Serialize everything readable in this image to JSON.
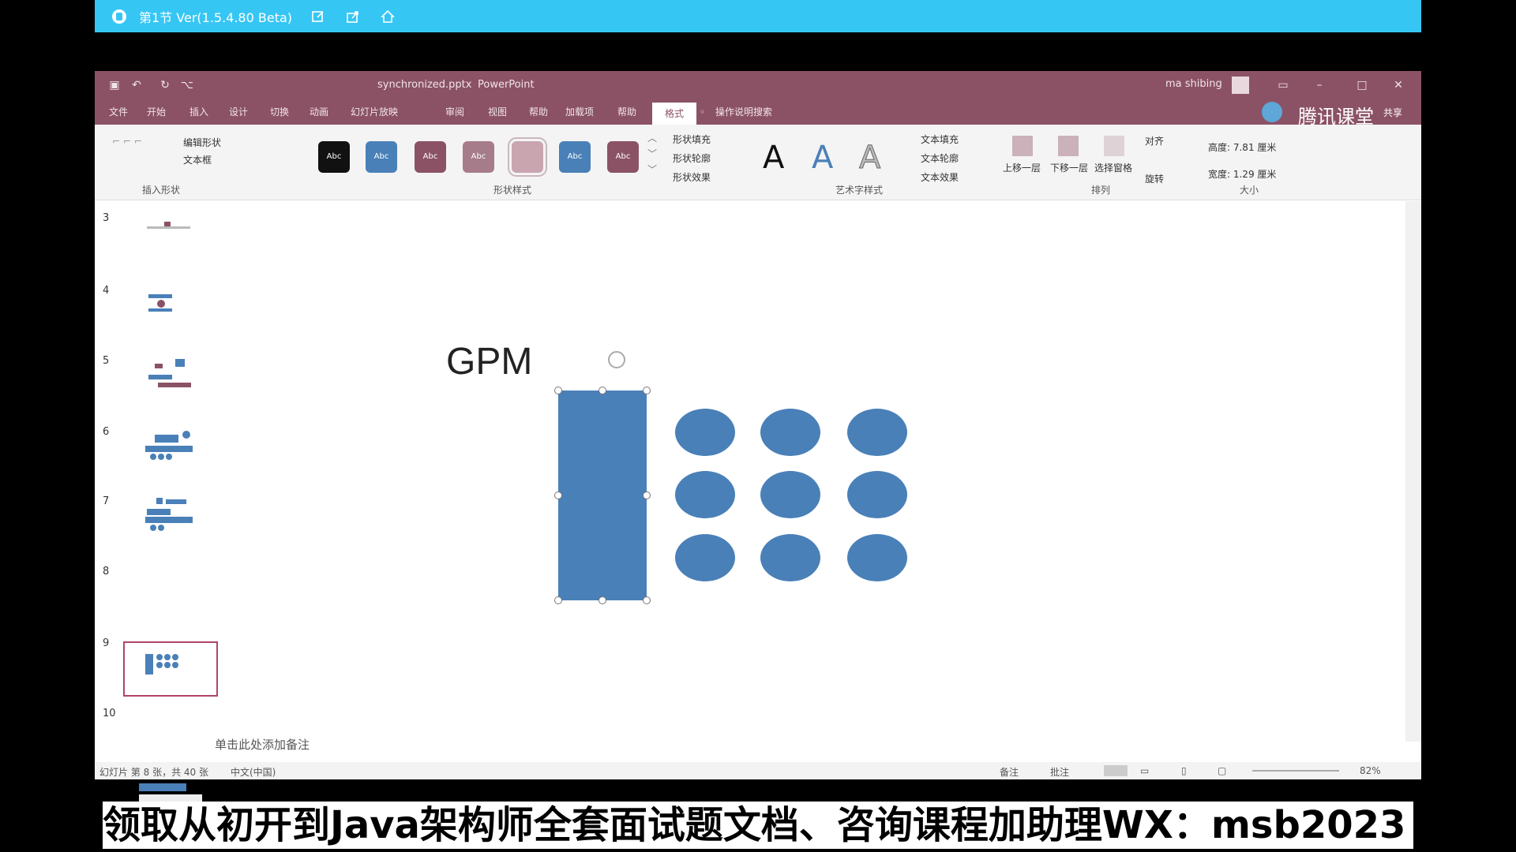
{
  "player": {
    "title": "第1节 Ver(1.5.4.80 Beta)",
    "buttons": [
      "edit-icon",
      "share-icon",
      "home-icon"
    ]
  },
  "window": {
    "document_name": "synchronized.pptx",
    "app_name": "PowerPoint",
    "user_name": "ma shibing",
    "quick_access": [
      "save-icon",
      "undo-icon",
      "redo-icon"
    ]
  },
  "tabs": [
    {
      "label": "文件"
    },
    {
      "label": "开始"
    },
    {
      "label": "插入"
    },
    {
      "label": "设计"
    },
    {
      "label": "切换"
    },
    {
      "label": "动画"
    },
    {
      "label": "幻灯片放映"
    },
    {
      "label": "审阅"
    },
    {
      "label": "视图"
    },
    {
      "label": "帮助"
    },
    {
      "label": "加载项"
    },
    {
      "label": "帮助"
    },
    {
      "label": "格式"
    }
  ],
  "tell_me": "操作说明搜索",
  "brand": {
    "name": "腾讯课堂",
    "share": "共享"
  },
  "ribbon": {
    "insert_shapes": {
      "edit_shape": "编辑形状",
      "text_box": "文本框",
      "label": "插入形状"
    },
    "shape_styles": {
      "swatch_text": "Abc",
      "swatch_colors": [
        "#111111",
        "#4a80b8",
        "#8b5266",
        "#a67c8b",
        "#c9a5b0",
        "#4a80b8",
        "#8b5266"
      ],
      "fill": "形状填充",
      "outline": "形状轮廓",
      "effects": "形状效果",
      "label": "形状样式"
    },
    "wordart": {
      "glyph": "A",
      "text_fill": "文本填充",
      "text_outline": "文本轮廓",
      "text_effects": "文本效果",
      "label": "艺术字样式"
    },
    "arrange": {
      "bring_forward": "上移一层",
      "send_backward": "下移一层",
      "selection_pane": "选择窗格",
      "align": "对齐",
      "rotate": "旋转",
      "label": "排列"
    },
    "size": {
      "height": "高度: 7.81 厘米",
      "width": "宽度: 1.29 厘米",
      "label": "大小"
    }
  },
  "thumbnails": [
    {
      "num": "3"
    },
    {
      "num": "4"
    },
    {
      "num": "5"
    },
    {
      "num": "6"
    },
    {
      "num": "7"
    },
    {
      "num": "8",
      "selected": true
    },
    {
      "num": "9"
    },
    {
      "num": "10"
    }
  ],
  "slide": {
    "title": "GPM",
    "shape_color": "#4a80b8"
  },
  "notes_placeholder": "单击此处添加备注",
  "status": {
    "slide_info": "幻灯片 第 8 张，共 40 张",
    "language": "中文(中国)",
    "notes": "备注",
    "comments": "批注",
    "zoom": "82%"
  },
  "caption": "领取从初开到Java架构师全套面试题文档、咨询课程加助理WX：msb2023"
}
